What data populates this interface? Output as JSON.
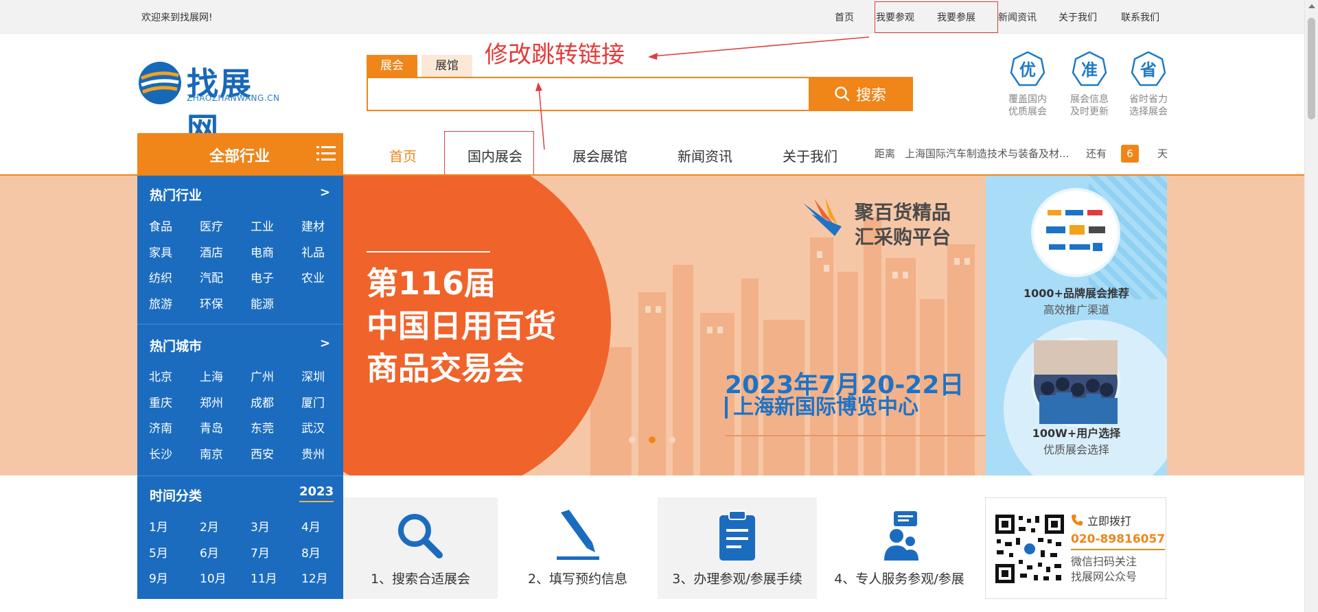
{
  "topbar": {
    "welcome": "欢迎来到找展网!",
    "links": [
      "首页",
      "我要参观",
      "我要参展",
      "新闻资讯",
      "关于我们",
      "联系我们"
    ]
  },
  "annotation": {
    "text": "修改跳转链接"
  },
  "logo": {
    "cn": "找展网",
    "en": "ZHAOZHANWANG.CN"
  },
  "search": {
    "tabs": [
      "展会",
      "展馆"
    ],
    "placeholder": "",
    "button": "搜索"
  },
  "badges": [
    {
      "char": "优",
      "line1": "覆盖国内",
      "line2": "优质展会"
    },
    {
      "char": "准",
      "line1": "展会信息",
      "line2": "及时更新"
    },
    {
      "char": "省",
      "line1": "省时省力",
      "line2": "选择展会"
    }
  ],
  "nav": {
    "category_label": "全部行业",
    "items": [
      "首页",
      "国内展会",
      "展会展馆",
      "新闻资讯",
      "关于我们"
    ],
    "countdown": {
      "prefix": "距离",
      "event": "上海国际汽车制造技术与装备及材...",
      "middle": "还有",
      "days": "6",
      "suffix": "天"
    }
  },
  "sidebar": {
    "hot_industry": {
      "title": "热门行业",
      "arrow": ">",
      "items": [
        "食品",
        "医疗",
        "工业",
        "建材",
        "家具",
        "酒店",
        "电商",
        "礼品",
        "纺织",
        "汽配",
        "电子",
        "农业",
        "旅游",
        "环保",
        "能源"
      ]
    },
    "hot_city": {
      "title": "热门城市",
      "arrow": ">",
      "items": [
        "北京",
        "上海",
        "广州",
        "深圳",
        "重庆",
        "郑州",
        "成都",
        "厦门",
        "济南",
        "青岛",
        "东莞",
        "武汉",
        "长沙",
        "南京",
        "西安",
        "贵州"
      ]
    },
    "time": {
      "title": "时间分类",
      "year": "2023",
      "items": [
        "1月",
        "2月",
        "3月",
        "4月",
        "5月",
        "6月",
        "7月",
        "8月",
        "9月",
        "10月",
        "11月",
        "12月"
      ]
    }
  },
  "banner": {
    "title_lines": [
      "第116届",
      "中国日用百货",
      "商品交易会"
    ],
    "slogan_lines": [
      "聚百货精品",
      "汇采购平台"
    ],
    "date": "2023年7月20-22日",
    "venue": "上海新国际博览中心",
    "right_1_bold": "1000+品牌展会推荐",
    "right_1_sub": "高效推广渠道",
    "right_2_bold": "100W+用户选择",
    "right_2_sub": "优质展会选择"
  },
  "steps": [
    "1、搜索合适展会",
    "2、填写预约信息",
    "3、办理参观/参展手续",
    "4、专人服务参观/参展"
  ],
  "contact": {
    "call": "立即拨打",
    "phone": "020-89816057",
    "note_line1": "微信扫码关注",
    "note_line2": "找展网公众号"
  },
  "colors": {
    "accent": "#f08519",
    "brand_blue": "#1b6cbf",
    "annotation_red": "#e23b3b",
    "banner_peach": "#f6c7a6"
  }
}
